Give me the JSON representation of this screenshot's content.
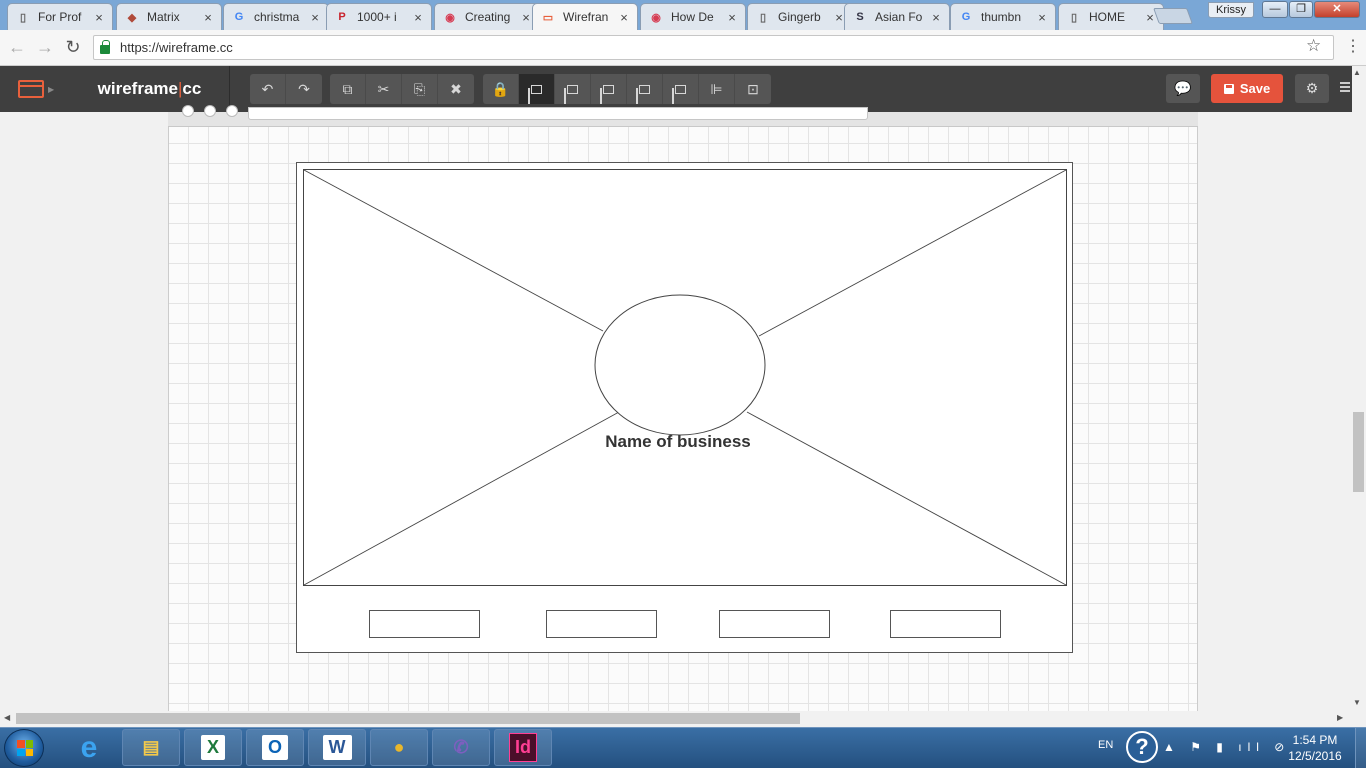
{
  "browser": {
    "tabs": [
      {
        "title": "For Prof",
        "icon": "doc-icon"
      },
      {
        "title": "Matrix",
        "icon": "matrix-cube-icon"
      },
      {
        "title": "christma",
        "icon": "google-icon"
      },
      {
        "title": "1000+ i",
        "icon": "pinterest-icon"
      },
      {
        "title": "Creating",
        "icon": "ga-icon"
      },
      {
        "title": "Wirefran",
        "icon": "wireframe-icon",
        "active": true
      },
      {
        "title": "How De",
        "icon": "ga-icon"
      },
      {
        "title": "Gingerb",
        "icon": "doc-icon"
      },
      {
        "title": "Asian Fo",
        "icon": "s-logo-icon"
      },
      {
        "title": "thumbn",
        "icon": "google-icon"
      },
      {
        "title": "HOME",
        "icon": "doc-icon"
      }
    ],
    "tab_close_glyph": "×",
    "profile_name": "Krissy",
    "window_controls": {
      "minimize": "—",
      "maximize": "❐",
      "close": "✕"
    },
    "url": "https://wireframe.cc",
    "nav": {
      "back": "←",
      "forward": "→",
      "reload": "↻",
      "star": "☆",
      "menu": "⋮"
    }
  },
  "app": {
    "brand_left": "wireframe",
    "brand_sep": "|",
    "brand_right": "cc",
    "tool_groups": [
      [
        {
          "name": "undo-icon",
          "glyph": "↶"
        },
        {
          "name": "redo-icon",
          "glyph": "↷"
        }
      ],
      [
        {
          "name": "duplicate-icon",
          "glyph": "⧉"
        },
        {
          "name": "cut-icon",
          "glyph": "✂"
        },
        {
          "name": "paste-icon",
          "glyph": "⎘"
        },
        {
          "name": "delete-icon",
          "glyph": "✖"
        }
      ],
      [
        {
          "name": "lock-icon",
          "glyph": "🔒"
        },
        {
          "name": "bring-front-icon",
          "glyph": "",
          "active": true
        },
        {
          "name": "bring-forward-icon",
          "glyph": ""
        },
        {
          "name": "send-backward-icon",
          "glyph": ""
        },
        {
          "name": "send-back-icon",
          "glyph": ""
        },
        {
          "name": "arrange-icon",
          "glyph": ""
        },
        {
          "name": "align-left-icon",
          "glyph": "⊫"
        },
        {
          "name": "group-icon",
          "glyph": "⊡"
        }
      ]
    ],
    "comment_glyph": "💬",
    "save_label": "Save",
    "settings_glyph": "⚙"
  },
  "canvas": {
    "business_name": "Name of business",
    "button_count": 4
  },
  "taskbar": {
    "apps": [
      {
        "name": "ie-icon",
        "glyph": "e",
        "color": "#3ba3f0"
      },
      {
        "name": "file-explorer-icon",
        "glyph": "▤",
        "color": "#f2c94c"
      },
      {
        "name": "excel-icon",
        "glyph": "X",
        "color": "#1f7a3d"
      },
      {
        "name": "outlook-icon",
        "glyph": "O",
        "color": "#0b63b6"
      },
      {
        "name": "word-icon",
        "glyph": "W",
        "color": "#2b5797"
      },
      {
        "name": "chrome-icon",
        "glyph": "●",
        "color": "#e9b72c"
      },
      {
        "name": "viber-icon",
        "glyph": "✆",
        "color": "#7d5fbf"
      },
      {
        "name": "indesign-icon",
        "glyph": "Id",
        "color": "#ff3f94"
      }
    ],
    "language": "EN",
    "help_glyph": "?",
    "tray_glyphs": "▲ ⚑ ▮ ıll ⊘",
    "time": "1:54 PM",
    "date": "12/5/2016"
  },
  "colors": {
    "accent": "#e5533c",
    "header_bg": "#3f3f3f",
    "taskbar_bg": "#24507f"
  }
}
